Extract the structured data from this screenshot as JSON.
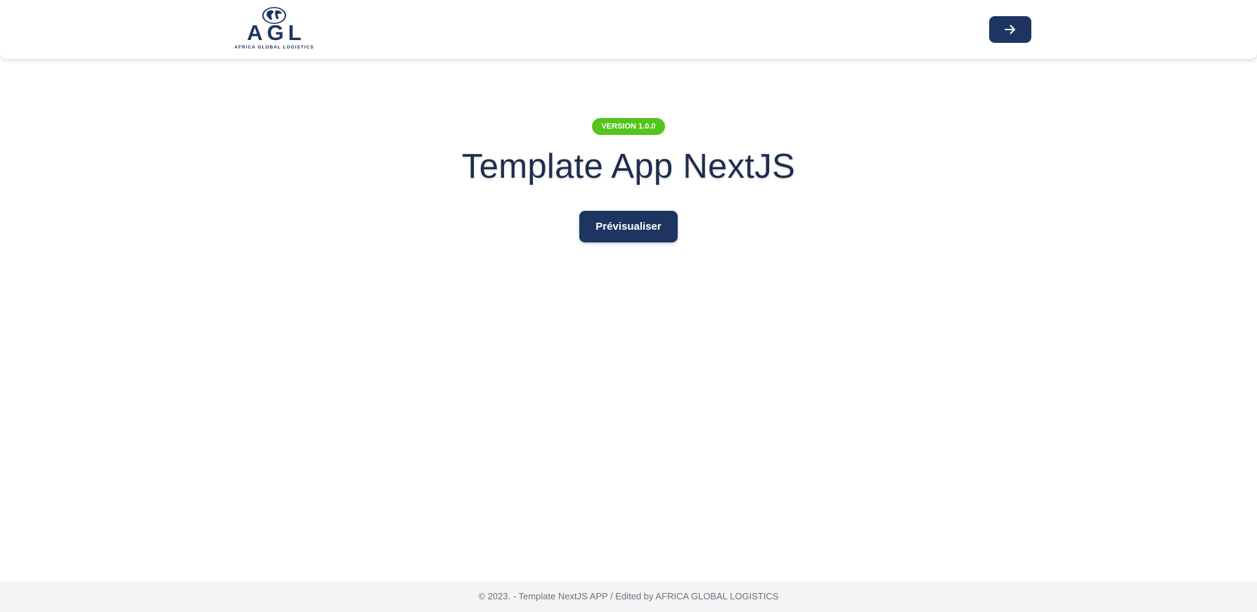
{
  "header": {
    "logo": {
      "letters": "AGL",
      "tagline": "AFRICA GLOBAL LOGISTICS",
      "icon": "globe-icon"
    },
    "login_button": {
      "icon": "arrow-right-icon"
    }
  },
  "hero": {
    "version_badge": "VERSION 1.0.0",
    "title": "Template App NextJS",
    "preview_button_label": "Prévisualiser"
  },
  "footer": {
    "text": "© 2023. - Template NextJS APP / Edited by AFRICA GLOBAL LOGISTICS"
  },
  "colors": {
    "brand_navy": "#1e3561",
    "badge_green": "#52c41a",
    "footer_bg": "#f4f4f5"
  }
}
